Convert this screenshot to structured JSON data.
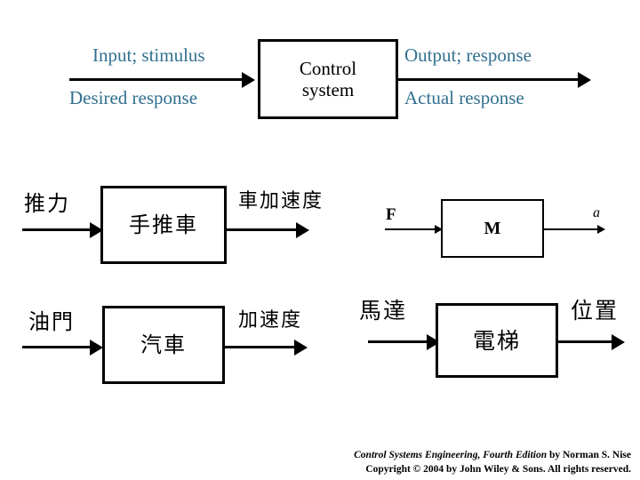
{
  "diagram": {
    "top_block": {
      "input_label_line1": "Input; stimulus",
      "input_label_line2": "Desired response",
      "box_line1": "Control",
      "box_line2": "system",
      "output_label_line1": "Output; response",
      "output_label_line2": "Actual response"
    },
    "rows": [
      {
        "input_label": "推力",
        "box_label": "手推車",
        "output_label": "車加速度"
      },
      {
        "input_label": "F",
        "box_label": "M",
        "output_label": "a"
      },
      {
        "input_label": "油門",
        "box_label": "汽車",
        "output_label": "加速度"
      },
      {
        "input_label": "馬達",
        "box_label": "電梯",
        "output_label": "位置"
      }
    ]
  },
  "footer": {
    "line1_italic": "Control Systems Engineering, Fourth Edition",
    "line1_rest": " by Norman S. Nise",
    "line2": "Copyright © 2004 by John Wiley & Sons. All rights reserved."
  },
  "colors": {
    "label_blue": "#31708f",
    "stroke": "#000000",
    "background": "#ffffff"
  }
}
